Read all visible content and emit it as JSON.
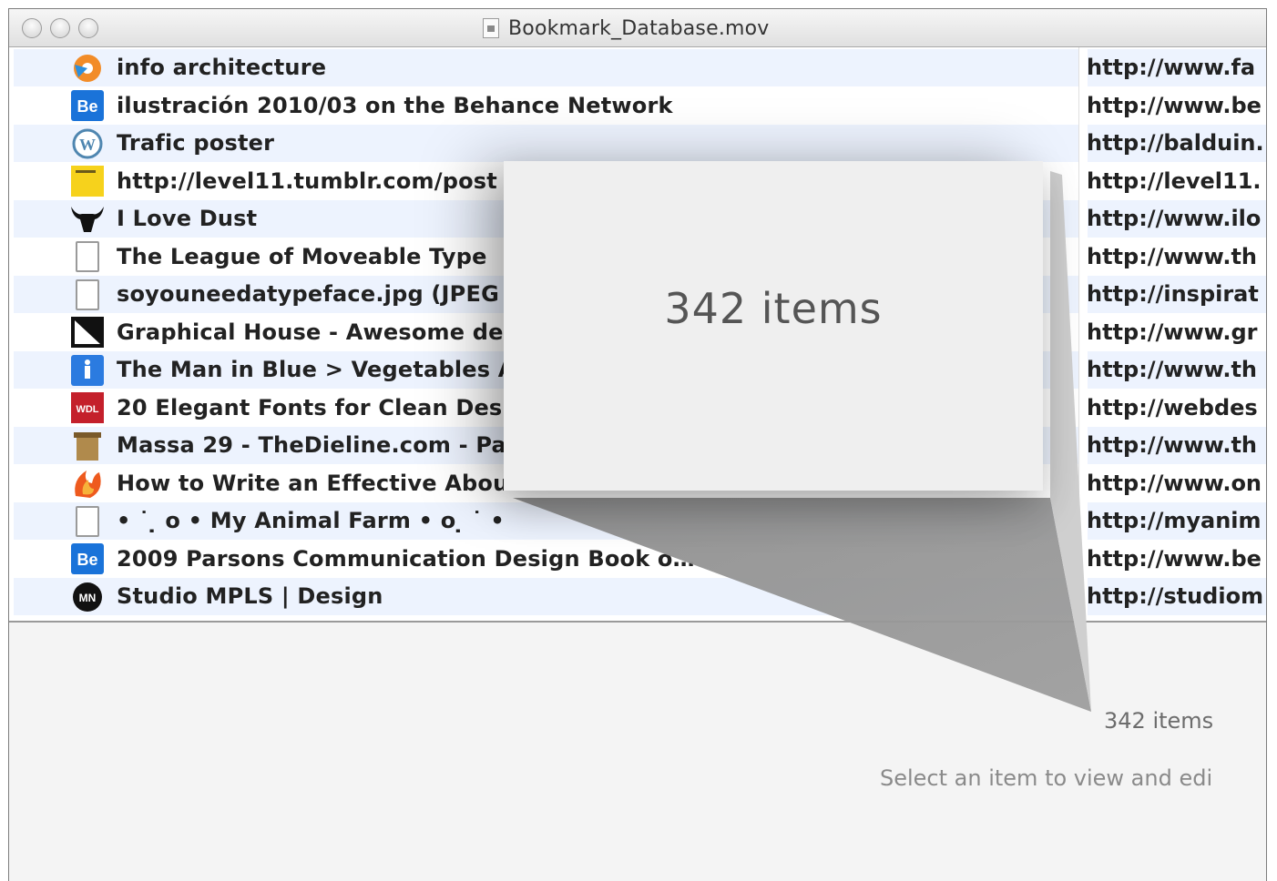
{
  "window": {
    "title": "Bookmark_Database.mov"
  },
  "rows": [
    {
      "name": "info architecture",
      "url": "http://www.fa",
      "icon": "orange-globe-icon",
      "color": "#f28c28"
    },
    {
      "name": "ilustración 2010/03 on the Behance Network",
      "url": "http://www.be",
      "icon": "behance-icon",
      "color": "#1a73d9"
    },
    {
      "name": "Trafic poster",
      "url": "http://balduin.",
      "icon": "wordpress-icon",
      "color": "#4f86b0"
    },
    {
      "name": "http://level11.tumblr.com/post",
      "url": "http://level11.",
      "icon": "yellow-note-icon",
      "color": "#f6d21c"
    },
    {
      "name": "I Love Dust",
      "url": "http://www.ilo",
      "icon": "bull-icon",
      "color": "#111111"
    },
    {
      "name": "The League of Moveable Type",
      "url": "http://www.th",
      "icon": "document-icon",
      "color": "#9a9a9a"
    },
    {
      "name": "soyouneedatypeface.jpg (JPEG In",
      "url": "http://inspirat",
      "icon": "document-icon",
      "color": "#9a9a9a"
    },
    {
      "name": "Graphical House - Awesome des",
      "url": "http://www.gr",
      "icon": "graphical-house-icon",
      "color": "#111111"
    },
    {
      "name": "The Man in Blue > Vegetables A",
      "url": "http://www.th",
      "icon": "man-in-blue-icon",
      "color": "#2b7be0"
    },
    {
      "name": "20 Elegant Fonts for Clean Desig",
      "url": "http://webdes",
      "icon": "wdl-icon",
      "color": "#c4202b"
    },
    {
      "name": "Massa 29 - TheDieline.com - Pa",
      "url": "http://www.th",
      "icon": "dieline-icon",
      "color": "#b08a4c"
    },
    {
      "name": "How to Write an Effective About",
      "url": "http://www.on",
      "icon": "flame-icon",
      "color": "#ee5a1e"
    },
    {
      "name": "• ˙ ̣ o • My Animal Farm • o ̣ ˙ •",
      "url": "http://myanim",
      "icon": "document-icon",
      "color": "#9a9a9a"
    },
    {
      "name": "2009 Parsons Communication Design Book o…",
      "url": "http://www.be",
      "icon": "behance-icon",
      "color": "#1a73d9"
    },
    {
      "name": "Studio MPLS | Design",
      "url": "http://studiom",
      "icon": "studio-mpls-icon",
      "color": "#111111"
    }
  ],
  "popover": {
    "count_label": "342 items"
  },
  "detail": {
    "count_label": "342 items",
    "hint": "Select an item to view and edi"
  }
}
